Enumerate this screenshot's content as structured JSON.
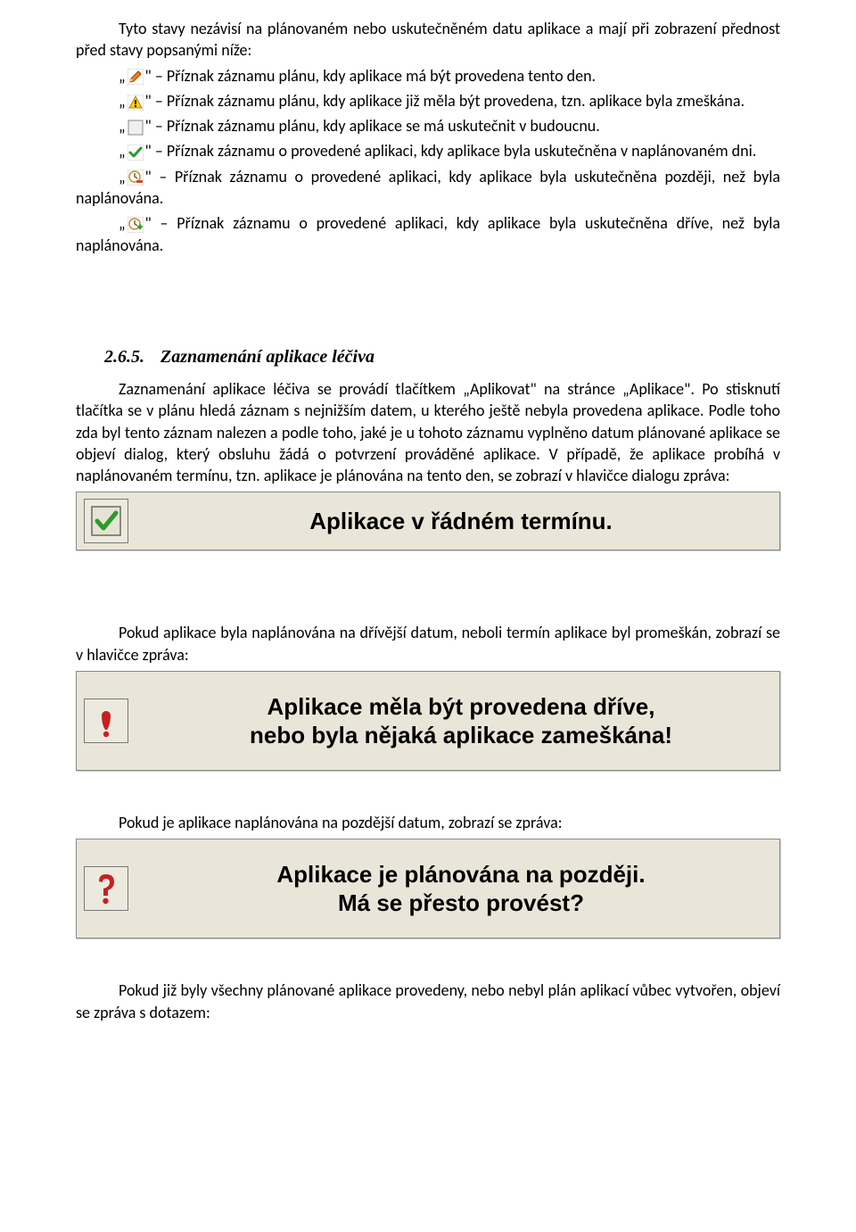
{
  "intro": "Tyto stavy nezávisí na plánovaném nebo uskutečněném datu aplikace a mají při zobrazení přednost před stavy popsanými níže:",
  "flags": [
    {
      "icon": "pencil-icon",
      "before": "„",
      "after": "\" – Příznak záznamu plánu, kdy aplikace má být provedena tento den."
    },
    {
      "icon": "warning-icon",
      "before": "„",
      "after": "\" – Příznak záznamu plánu, kdy aplikace již měla být provedena, tzn. aplikace byla zmeškána."
    },
    {
      "icon": "empty-box-icon",
      "before": "„",
      "after": "\" – Příznak záznamu plánu, kdy aplikace se má uskutečnit v budoucnu."
    },
    {
      "icon": "check-icon",
      "before": "„",
      "after": "\" – Příznak záznamu o provedené aplikaci, kdy aplikace byla uskutečněna v naplánovaném dni."
    },
    {
      "icon": "clock-minus-icon",
      "before": "„",
      "after": "\" – Příznak záznamu o provedené aplikaci, kdy aplikace byla uskutečněna později, než byla naplánována."
    },
    {
      "icon": "clock-plus-icon",
      "before": "„",
      "after": "\" – Příznak záznamu o provedené aplikaci, kdy aplikace byla uskutečněna dříve, než byla naplánována."
    }
  ],
  "section": {
    "number": "2.6.5.",
    "title": "Zaznamenání aplikace léčiva",
    "body": "Zaznamenání aplikace léčiva se provádí tlačítkem „Aplikovat\" na stránce „Aplikace\". Po stisknutí tlačítka se v plánu hledá záznam s nejnižším datem, u kterého ještě nebyla provedena aplikace. Podle toho zda byl tento záznam nalezen a podle toho, jaké je u tohoto záznamu vyplněno datum plánované aplikace se objeví dialog, který obsluhu žádá o potvrzení prováděné aplikace. V případě, že aplikace probíhá v naplánovaném termínu, tzn. aplikace je plánována na tento den, se zobrazí v hlavičce dialogu zpráva:"
  },
  "banner1": {
    "text": "Aplikace v řádném termínu."
  },
  "after1": "Pokud aplikace byla naplánována na dřívější datum, neboli termín aplikace byl promeškán, zobrazí se v hlavičce zpráva:",
  "banner2": {
    "line1": "Aplikace měla být provedena dříve,",
    "line2": "nebo byla nějaká aplikace zameškána!"
  },
  "after2": "Pokud je aplikace naplánována na pozdější datum, zobrazí se zpráva:",
  "banner3": {
    "line1": "Aplikace je plánována na později.",
    "line2": "Má se přesto provést?"
  },
  "after3": "Pokud již byly všechny plánované aplikace provedeny, nebo nebyl plán aplikací vůbec vytvořen, objeví se zpráva s dotazem:"
}
